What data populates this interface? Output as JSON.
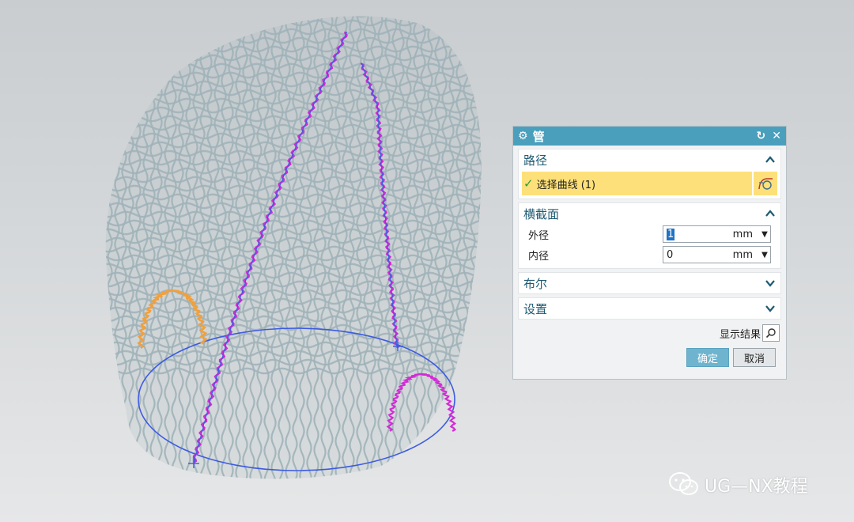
{
  "dialog": {
    "title": "管",
    "path_section": {
      "title": "路径",
      "selection_label": "选择曲线 (1)"
    },
    "cross_section": {
      "title": "横截面",
      "outer_diameter": {
        "label": "外径",
        "value": "1",
        "unit": "mm"
      },
      "inner_diameter": {
        "label": "内径",
        "value": "0",
        "unit": "mm"
      }
    },
    "boolean_section": {
      "title": "布尔"
    },
    "settings_section": {
      "title": "设置"
    },
    "show_result_label": "显示结果",
    "ok_label": "确定",
    "cancel_label": "取消"
  },
  "watermark": {
    "text": "UG—NX教程"
  },
  "colors": {
    "titlebar": "#4a9fbd",
    "selection_highlight": "#fde07a",
    "wire": "#9fb2b8",
    "path_magenta": "#d22bd6",
    "path_blue": "#3d5be0",
    "path_orange": "#f0a03c",
    "primary_button": "#6fb4cf"
  },
  "icons": {
    "titlebar": "gear-icon",
    "reset": "reset-icon",
    "close": "close-icon",
    "curve": "curve-select-icon",
    "show_result": "magnifier-icon",
    "watermark": "wechat-icon"
  }
}
